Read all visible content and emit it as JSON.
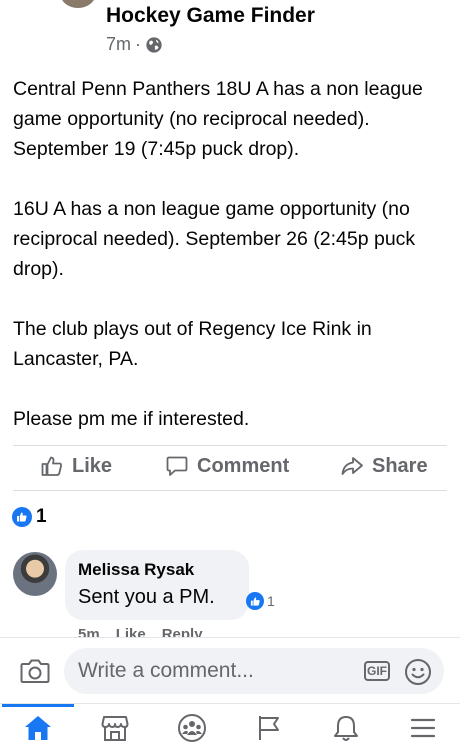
{
  "post": {
    "group_name": "Hockey Game Finder",
    "time_ago": "7m",
    "separator": "·",
    "paragraphs": [
      "Central Penn Panthers 18U A has a non league game opportunity (no reciprocal needed). September 19 (7:45p puck drop).",
      "16U A has a non league game opportunity (no reciprocal needed). September 26 (2:45p puck drop).",
      "The club plays out of Regency Ice Rink in Lancaster, PA.",
      "Please pm me if interested."
    ]
  },
  "actions": {
    "like": "Like",
    "comment": "Comment",
    "share": "Share"
  },
  "reactions": {
    "count": "1"
  },
  "comment": {
    "author": "Melissa Rysak",
    "text": "Sent you a PM.",
    "reaction_count": "1",
    "time_ago": "5m",
    "like_label": "Like",
    "reply_label": "Reply"
  },
  "composer": {
    "placeholder": "Write a comment...",
    "gif_label": "GIF"
  },
  "tabs": [
    "home-icon",
    "marketplace-icon",
    "groups-icon",
    "pages-flag-icon",
    "notifications-bell-icon",
    "menu-icon"
  ],
  "colors": {
    "accent": "#1877f2",
    "muted": "#65676b",
    "bubble": "#f0f2f5"
  }
}
